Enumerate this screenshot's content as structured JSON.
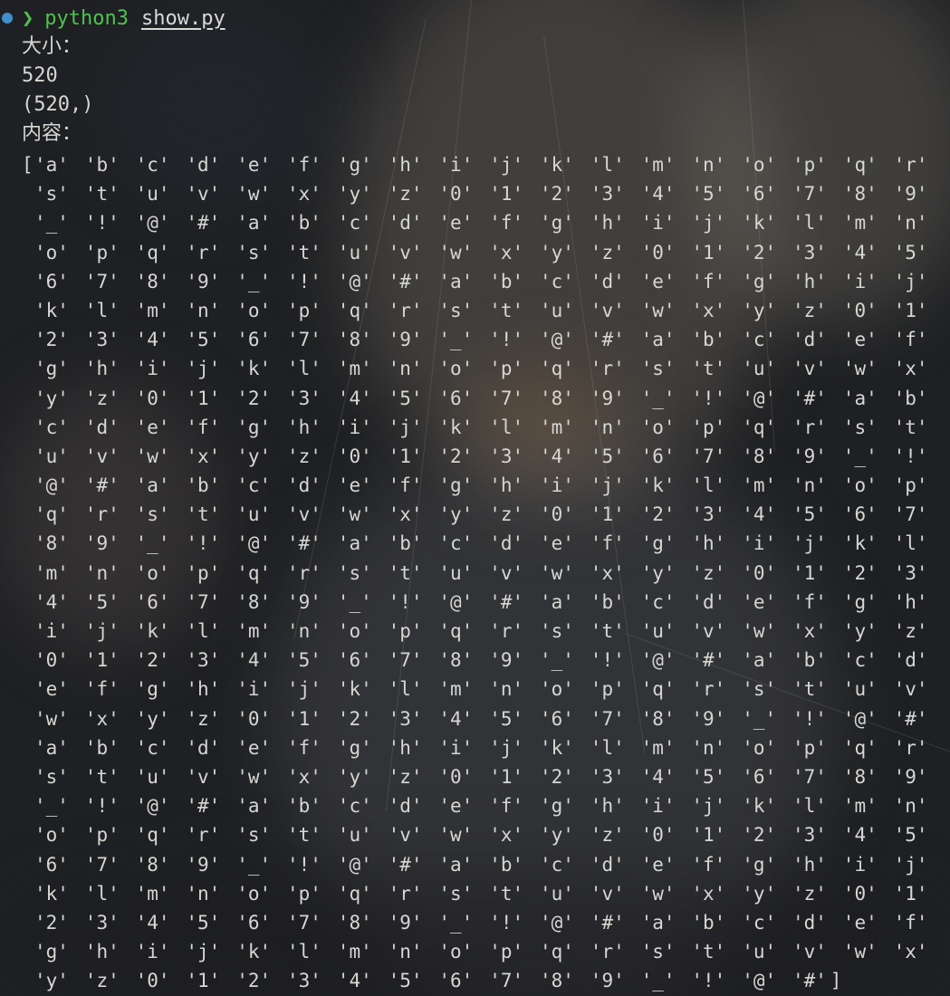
{
  "prompt": {
    "chevron": "❯",
    "command": "python3",
    "argument": "show.py"
  },
  "output": {
    "size_label": "大小：",
    "size_value": "520",
    "shape_value": "(520,)",
    "content_label": "内容："
  },
  "array": {
    "open_bracket": "[",
    "close_bracket": "]",
    "rows": [
      [
        "'a'",
        "'b'",
        "'c'",
        "'d'",
        "'e'",
        "'f'",
        "'g'",
        "'h'",
        "'i'",
        "'j'",
        "'k'",
        "'l'",
        "'m'",
        "'n'",
        "'o'",
        "'p'",
        "'q'",
        "'r'"
      ],
      [
        "'s'",
        "'t'",
        "'u'",
        "'v'",
        "'w'",
        "'x'",
        "'y'",
        "'z'",
        "'0'",
        "'1'",
        "'2'",
        "'3'",
        "'4'",
        "'5'",
        "'6'",
        "'7'",
        "'8'",
        "'9'"
      ],
      [
        "'_'",
        "'!'",
        "'@'",
        "'#'",
        "'a'",
        "'b'",
        "'c'",
        "'d'",
        "'e'",
        "'f'",
        "'g'",
        "'h'",
        "'i'",
        "'j'",
        "'k'",
        "'l'",
        "'m'",
        "'n'"
      ],
      [
        "'o'",
        "'p'",
        "'q'",
        "'r'",
        "'s'",
        "'t'",
        "'u'",
        "'v'",
        "'w'",
        "'x'",
        "'y'",
        "'z'",
        "'0'",
        "'1'",
        "'2'",
        "'3'",
        "'4'",
        "'5'"
      ],
      [
        "'6'",
        "'7'",
        "'8'",
        "'9'",
        "'_'",
        "'!'",
        "'@'",
        "'#'",
        "'a'",
        "'b'",
        "'c'",
        "'d'",
        "'e'",
        "'f'",
        "'g'",
        "'h'",
        "'i'",
        "'j'"
      ],
      [
        "'k'",
        "'l'",
        "'m'",
        "'n'",
        "'o'",
        "'p'",
        "'q'",
        "'r'",
        "'s'",
        "'t'",
        "'u'",
        "'v'",
        "'w'",
        "'x'",
        "'y'",
        "'z'",
        "'0'",
        "'1'"
      ],
      [
        "'2'",
        "'3'",
        "'4'",
        "'5'",
        "'6'",
        "'7'",
        "'8'",
        "'9'",
        "'_'",
        "'!'",
        "'@'",
        "'#'",
        "'a'",
        "'b'",
        "'c'",
        "'d'",
        "'e'",
        "'f'"
      ],
      [
        "'g'",
        "'h'",
        "'i'",
        "'j'",
        "'k'",
        "'l'",
        "'m'",
        "'n'",
        "'o'",
        "'p'",
        "'q'",
        "'r'",
        "'s'",
        "'t'",
        "'u'",
        "'v'",
        "'w'",
        "'x'"
      ],
      [
        "'y'",
        "'z'",
        "'0'",
        "'1'",
        "'2'",
        "'3'",
        "'4'",
        "'5'",
        "'6'",
        "'7'",
        "'8'",
        "'9'",
        "'_'",
        "'!'",
        "'@'",
        "'#'",
        "'a'",
        "'b'"
      ],
      [
        "'c'",
        "'d'",
        "'e'",
        "'f'",
        "'g'",
        "'h'",
        "'i'",
        "'j'",
        "'k'",
        "'l'",
        "'m'",
        "'n'",
        "'o'",
        "'p'",
        "'q'",
        "'r'",
        "'s'",
        "'t'"
      ],
      [
        "'u'",
        "'v'",
        "'w'",
        "'x'",
        "'y'",
        "'z'",
        "'0'",
        "'1'",
        "'2'",
        "'3'",
        "'4'",
        "'5'",
        "'6'",
        "'7'",
        "'8'",
        "'9'",
        "'_'",
        "'!'"
      ],
      [
        "'@'",
        "'#'",
        "'a'",
        "'b'",
        "'c'",
        "'d'",
        "'e'",
        "'f'",
        "'g'",
        "'h'",
        "'i'",
        "'j'",
        "'k'",
        "'l'",
        "'m'",
        "'n'",
        "'o'",
        "'p'"
      ],
      [
        "'q'",
        "'r'",
        "'s'",
        "'t'",
        "'u'",
        "'v'",
        "'w'",
        "'x'",
        "'y'",
        "'z'",
        "'0'",
        "'1'",
        "'2'",
        "'3'",
        "'4'",
        "'5'",
        "'6'",
        "'7'"
      ],
      [
        "'8'",
        "'9'",
        "'_'",
        "'!'",
        "'@'",
        "'#'",
        "'a'",
        "'b'",
        "'c'",
        "'d'",
        "'e'",
        "'f'",
        "'g'",
        "'h'",
        "'i'",
        "'j'",
        "'k'",
        "'l'"
      ],
      [
        "'m'",
        "'n'",
        "'o'",
        "'p'",
        "'q'",
        "'r'",
        "'s'",
        "'t'",
        "'u'",
        "'v'",
        "'w'",
        "'x'",
        "'y'",
        "'z'",
        "'0'",
        "'1'",
        "'2'",
        "'3'"
      ],
      [
        "'4'",
        "'5'",
        "'6'",
        "'7'",
        "'8'",
        "'9'",
        "'_'",
        "'!'",
        "'@'",
        "'#'",
        "'a'",
        "'b'",
        "'c'",
        "'d'",
        "'e'",
        "'f'",
        "'g'",
        "'h'"
      ],
      [
        "'i'",
        "'j'",
        "'k'",
        "'l'",
        "'m'",
        "'n'",
        "'o'",
        "'p'",
        "'q'",
        "'r'",
        "'s'",
        "'t'",
        "'u'",
        "'v'",
        "'w'",
        "'x'",
        "'y'",
        "'z'"
      ],
      [
        "'0'",
        "'1'",
        "'2'",
        "'3'",
        "'4'",
        "'5'",
        "'6'",
        "'7'",
        "'8'",
        "'9'",
        "'_'",
        "'!'",
        "'@'",
        "'#'",
        "'a'",
        "'b'",
        "'c'",
        "'d'"
      ],
      [
        "'e'",
        "'f'",
        "'g'",
        "'h'",
        "'i'",
        "'j'",
        "'k'",
        "'l'",
        "'m'",
        "'n'",
        "'o'",
        "'p'",
        "'q'",
        "'r'",
        "'s'",
        "'t'",
        "'u'",
        "'v'"
      ],
      [
        "'w'",
        "'x'",
        "'y'",
        "'z'",
        "'0'",
        "'1'",
        "'2'",
        "'3'",
        "'4'",
        "'5'",
        "'6'",
        "'7'",
        "'8'",
        "'9'",
        "'_'",
        "'!'",
        "'@'",
        "'#'"
      ],
      [
        "'a'",
        "'b'",
        "'c'",
        "'d'",
        "'e'",
        "'f'",
        "'g'",
        "'h'",
        "'i'",
        "'j'",
        "'k'",
        "'l'",
        "'m'",
        "'n'",
        "'o'",
        "'p'",
        "'q'",
        "'r'"
      ],
      [
        "'s'",
        "'t'",
        "'u'",
        "'v'",
        "'w'",
        "'x'",
        "'y'",
        "'z'",
        "'0'",
        "'1'",
        "'2'",
        "'3'",
        "'4'",
        "'5'",
        "'6'",
        "'7'",
        "'8'",
        "'9'"
      ],
      [
        "'_'",
        "'!'",
        "'@'",
        "'#'",
        "'a'",
        "'b'",
        "'c'",
        "'d'",
        "'e'",
        "'f'",
        "'g'",
        "'h'",
        "'i'",
        "'j'",
        "'k'",
        "'l'",
        "'m'",
        "'n'"
      ],
      [
        "'o'",
        "'p'",
        "'q'",
        "'r'",
        "'s'",
        "'t'",
        "'u'",
        "'v'",
        "'w'",
        "'x'",
        "'y'",
        "'z'",
        "'0'",
        "'1'",
        "'2'",
        "'3'",
        "'4'",
        "'5'"
      ],
      [
        "'6'",
        "'7'",
        "'8'",
        "'9'",
        "'_'",
        "'!'",
        "'@'",
        "'#'",
        "'a'",
        "'b'",
        "'c'",
        "'d'",
        "'e'",
        "'f'",
        "'g'",
        "'h'",
        "'i'",
        "'j'"
      ],
      [
        "'k'",
        "'l'",
        "'m'",
        "'n'",
        "'o'",
        "'p'",
        "'q'",
        "'r'",
        "'s'",
        "'t'",
        "'u'",
        "'v'",
        "'w'",
        "'x'",
        "'y'",
        "'z'",
        "'0'",
        "'1'"
      ],
      [
        "'2'",
        "'3'",
        "'4'",
        "'5'",
        "'6'",
        "'7'",
        "'8'",
        "'9'",
        "'_'",
        "'!'",
        "'@'",
        "'#'",
        "'a'",
        "'b'",
        "'c'",
        "'d'",
        "'e'",
        "'f'"
      ],
      [
        "'g'",
        "'h'",
        "'i'",
        "'j'",
        "'k'",
        "'l'",
        "'m'",
        "'n'",
        "'o'",
        "'p'",
        "'q'",
        "'r'",
        "'s'",
        "'t'",
        "'u'",
        "'v'",
        "'w'",
        "'x'"
      ],
      [
        "'y'",
        "'z'",
        "'0'",
        "'1'",
        "'2'",
        "'3'",
        "'4'",
        "'5'",
        "'6'",
        "'7'",
        "'8'",
        "'9'",
        "'_'",
        "'!'",
        "'@'",
        "'#'"
      ]
    ]
  },
  "colors": {
    "background": "#1f2023",
    "prompt_green": "#4fc14f",
    "status_dot": "#3f8fcf",
    "text": "#d6d6d2"
  }
}
